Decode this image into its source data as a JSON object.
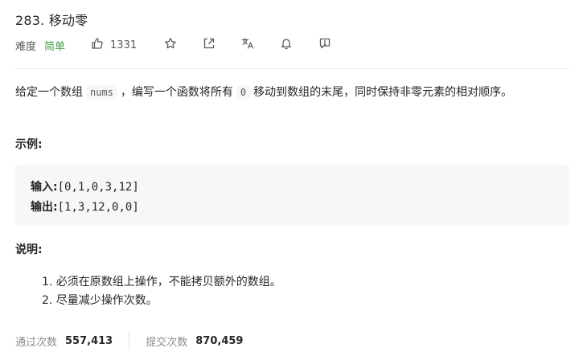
{
  "problem": {
    "title": "283. 移动零",
    "difficulty_label": "难度",
    "difficulty_value": "简单",
    "difficulty_color": "#43a047",
    "like_count": "1331",
    "icons": [
      "thumbs-up-icon",
      "star-icon",
      "share-icon",
      "translate-icon",
      "bell-icon",
      "report-icon"
    ]
  },
  "description": {
    "part1": "给定一个数组",
    "code1": "nums",
    "part2": "，编写一个函数将所有",
    "code2": "0",
    "part3": "移动到数组的末尾，同时保持非零元素的相对顺序。"
  },
  "example": {
    "heading": "示例:",
    "input_label": "输入:",
    "input_value": "[0,1,0,3,12]",
    "output_label": "输出:",
    "output_value": "[1,3,12,0,0]"
  },
  "notes": {
    "heading": "说明:",
    "items": [
      "1. 必须在原数组上操作，不能拷贝额外的数组。",
      "2. 尽量减少操作次数。"
    ]
  },
  "stats": {
    "accepted_label": "通过次数",
    "accepted_value": "557,413",
    "submitted_label": "提交次数",
    "submitted_value": "870,459"
  }
}
